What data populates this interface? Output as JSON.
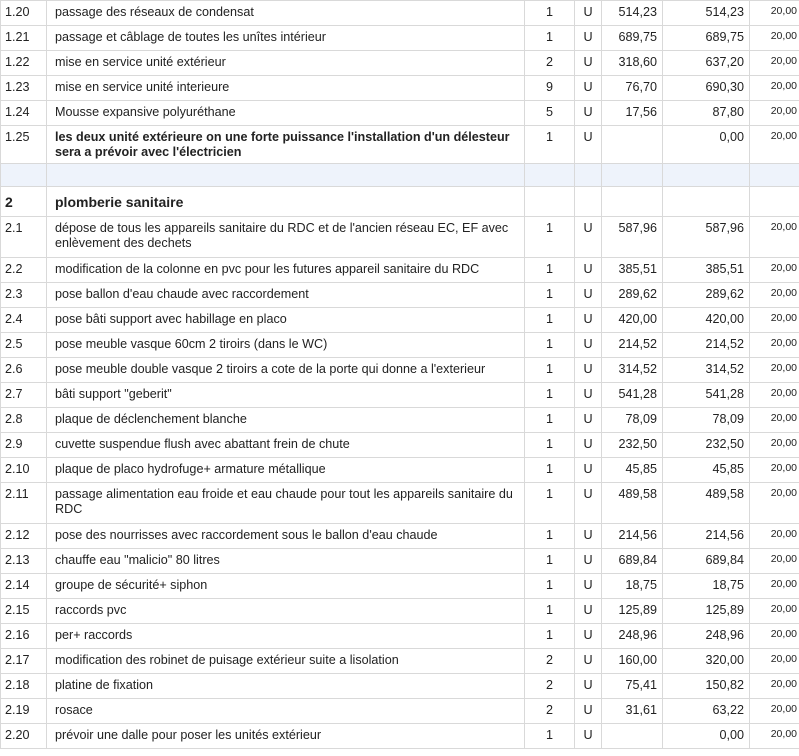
{
  "rows": [
    {
      "num": "1.20",
      "desc": "passage des réseaux de condensat",
      "qty": "1",
      "unit": "U",
      "pu": "514,23",
      "total": "514,23",
      "tva": "20,00"
    },
    {
      "num": "1.21",
      "desc": "passage et câblage de toutes les unîtes intérieur",
      "qty": "1",
      "unit": "U",
      "pu": "689,75",
      "total": "689,75",
      "tva": "20,00"
    },
    {
      "num": "1.22",
      "desc": "mise en service unité extérieur",
      "qty": "2",
      "unit": "U",
      "pu": "318,60",
      "total": "637,20",
      "tva": "20,00"
    },
    {
      "num": "1.23",
      "desc": "mise en service unité interieure",
      "qty": "9",
      "unit": "U",
      "pu": "76,70",
      "total": "690,30",
      "tva": "20,00"
    },
    {
      "num": "1.24",
      "desc": "Mousse expansive polyuréthane",
      "qty": "5",
      "unit": "U",
      "pu": "17,56",
      "total": "87,80",
      "tva": "20,00"
    },
    {
      "num": "1.25",
      "desc": "les deux unité extérieure on une forte puissance l'installation d'un délesteur sera a prévoir avec l'électricien",
      "qty": "1",
      "unit": "U",
      "pu": "",
      "total": "0,00",
      "tva": "20,00"
    }
  ],
  "section": {
    "num": "2",
    "title": "plomberie sanitaire"
  },
  "rows2": [
    {
      "num": "2.1",
      "desc": "dépose de tous les appareils sanitaire du RDC et de l'ancien réseau EC, EF avec enlèvement des dechets",
      "qty": "1",
      "unit": "U",
      "pu": "587,96",
      "total": "587,96",
      "tva": "20,00"
    },
    {
      "num": "2.2",
      "desc": "modification de la colonne en pvc pour les futures appareil sanitaire du RDC",
      "qty": "1",
      "unit": "U",
      "pu": "385,51",
      "total": "385,51",
      "tva": "20,00"
    },
    {
      "num": "2.3",
      "desc": "pose ballon d'eau chaude avec raccordement",
      "qty": "1",
      "unit": "U",
      "pu": "289,62",
      "total": "289,62",
      "tva": "20,00"
    },
    {
      "num": "2.4",
      "desc": "pose bâti support avec habillage en placo",
      "qty": "1",
      "unit": "U",
      "pu": "420,00",
      "total": "420,00",
      "tva": "20,00"
    },
    {
      "num": "2.5",
      "desc": "pose meuble vasque 60cm 2 tiroirs (dans le WC)",
      "qty": "1",
      "unit": "U",
      "pu": "214,52",
      "total": "214,52",
      "tva": "20,00"
    },
    {
      "num": "2.6",
      "desc": "pose meuble double vasque 2 tiroirs a cote de la porte qui donne a l'exterieur",
      "qty": "1",
      "unit": "U",
      "pu": "314,52",
      "total": "314,52",
      "tva": "20,00"
    },
    {
      "num": "2.7",
      "desc": "bâti support \"geberit\"",
      "qty": "1",
      "unit": "U",
      "pu": "541,28",
      "total": "541,28",
      "tva": "20,00"
    },
    {
      "num": "2.8",
      "desc": "plaque de déclenchement blanche",
      "qty": "1",
      "unit": "U",
      "pu": "78,09",
      "total": "78,09",
      "tva": "20,00"
    },
    {
      "num": "2.9",
      "desc": "cuvette suspendue flush avec abattant frein de chute",
      "qty": "1",
      "unit": "U",
      "pu": "232,50",
      "total": "232,50",
      "tva": "20,00"
    },
    {
      "num": "2.10",
      "desc": "plaque de placo hydrofuge+ armature métallique",
      "qty": "1",
      "unit": "U",
      "pu": "45,85",
      "total": "45,85",
      "tva": "20,00"
    },
    {
      "num": "2.11",
      "desc": "passage alimentation eau froide et eau chaude pour tout les appareils sanitaire du RDC",
      "qty": "1",
      "unit": "U",
      "pu": "489,58",
      "total": "489,58",
      "tva": "20,00"
    },
    {
      "num": "2.12",
      "desc": "pose des nourrisses avec raccordement sous le ballon d'eau chaude",
      "qty": "1",
      "unit": "U",
      "pu": "214,56",
      "total": "214,56",
      "tva": "20,00"
    },
    {
      "num": "2.13",
      "desc": "chauffe eau \"malicio\" 80 litres",
      "qty": "1",
      "unit": "U",
      "pu": "689,84",
      "total": "689,84",
      "tva": "20,00"
    },
    {
      "num": "2.14",
      "desc": "groupe de sécurité+ siphon",
      "qty": "1",
      "unit": "U",
      "pu": "18,75",
      "total": "18,75",
      "tva": "20,00"
    },
    {
      "num": "2.15",
      "desc": "raccords pvc",
      "qty": "1",
      "unit": "U",
      "pu": "125,89",
      "total": "125,89",
      "tva": "20,00"
    },
    {
      "num": "2.16",
      "desc": "per+ raccords",
      "qty": "1",
      "unit": "U",
      "pu": "248,96",
      "total": "248,96",
      "tva": "20,00"
    },
    {
      "num": "2.17",
      "desc": "modification des robinet de puisage extérieur suite a lisolation",
      "qty": "2",
      "unit": "U",
      "pu": "160,00",
      "total": "320,00",
      "tva": "20,00"
    },
    {
      "num": "2.18",
      "desc": "platine de fixation",
      "qty": "2",
      "unit": "U",
      "pu": "75,41",
      "total": "150,82",
      "tva": "20,00"
    },
    {
      "num": "2.19",
      "desc": "rosace",
      "qty": "2",
      "unit": "U",
      "pu": "31,61",
      "total": "63,22",
      "tva": "20,00"
    },
    {
      "num": "2.20",
      "desc": "prévoir une dalle pour poser les unités extérieur",
      "qty": "1",
      "unit": "U",
      "pu": "",
      "total": "0,00",
      "tva": "20,00"
    }
  ]
}
